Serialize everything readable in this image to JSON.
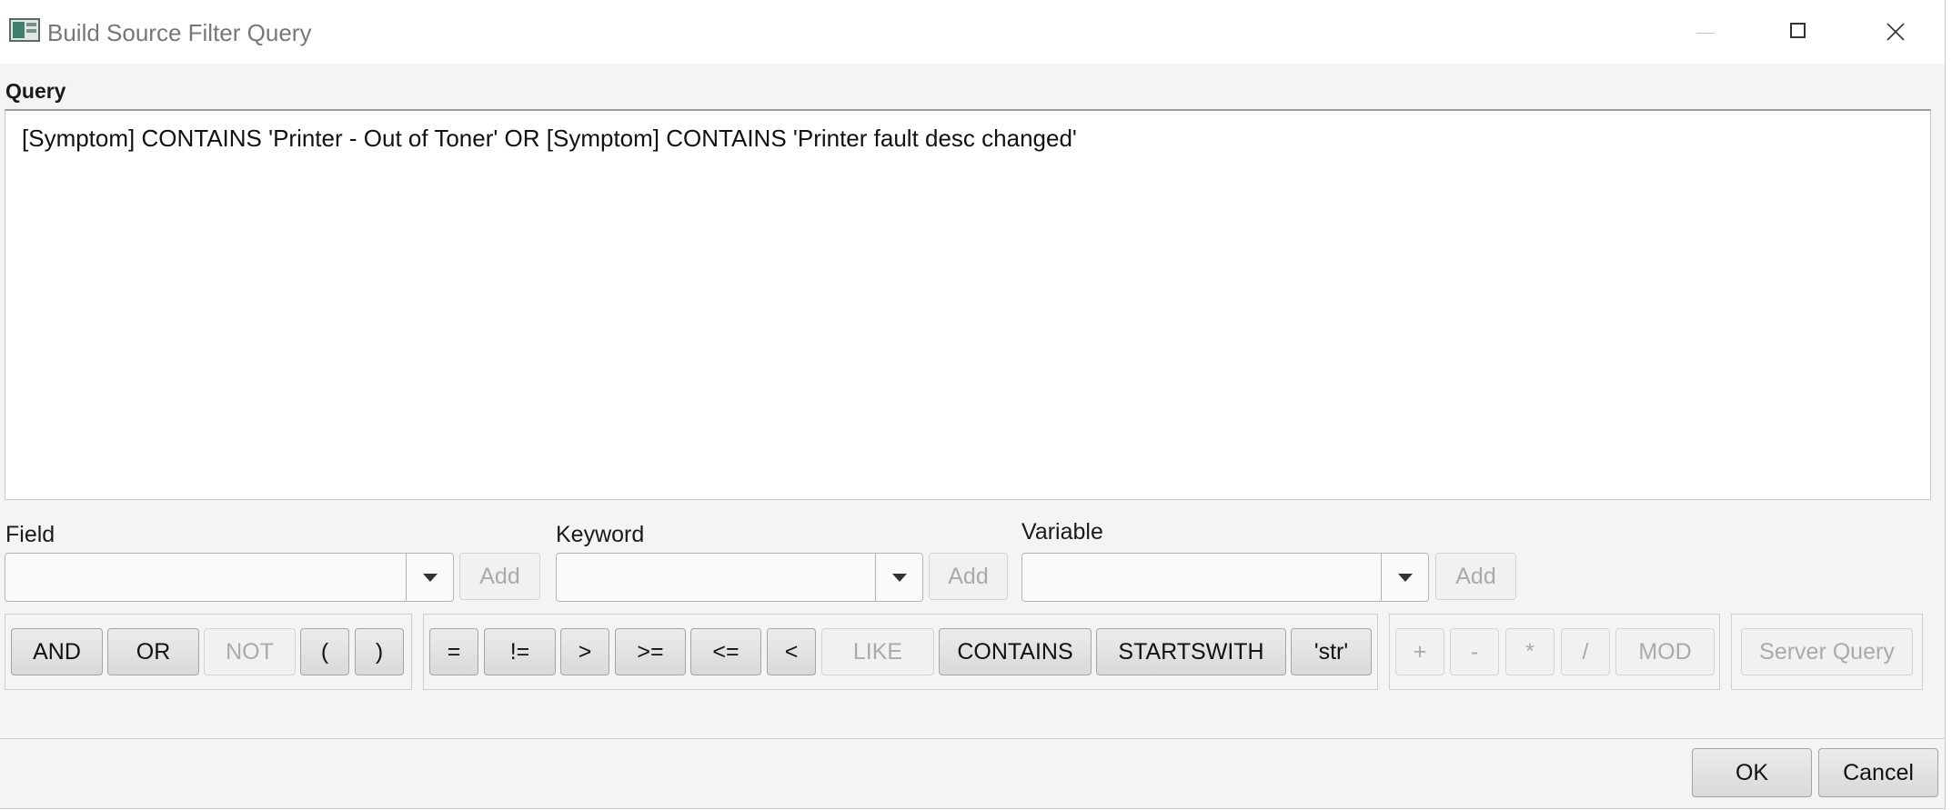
{
  "window": {
    "title": "Build Source Filter Query"
  },
  "query": {
    "label": "Query",
    "text": "[Symptom] CONTAINS 'Printer - Out of Toner' OR [Symptom] CONTAINS 'Printer fault desc changed'"
  },
  "field": {
    "label": "Field",
    "value": "",
    "add_label": "Add"
  },
  "keyword": {
    "label": "Keyword",
    "value": "",
    "add_label": "Add"
  },
  "variable": {
    "label": "Variable",
    "value": "",
    "add_label": "Add"
  },
  "logic_buttons": [
    {
      "label": "AND",
      "enabled": true
    },
    {
      "label": "OR",
      "enabled": true
    },
    {
      "label": "NOT",
      "enabled": false
    },
    {
      "label": "(",
      "enabled": true
    },
    {
      "label": ")",
      "enabled": true
    }
  ],
  "operator_buttons": [
    {
      "label": "=",
      "enabled": true
    },
    {
      "label": "!=",
      "enabled": true
    },
    {
      "label": ">",
      "enabled": true
    },
    {
      "label": ">=",
      "enabled": true
    },
    {
      "label": "<=",
      "enabled": true
    },
    {
      "label": "<",
      "enabled": true
    },
    {
      "label": "LIKE",
      "enabled": false
    },
    {
      "label": "CONTAINS",
      "enabled": true
    },
    {
      "label": "STARTSWITH",
      "enabled": true
    },
    {
      "label": "'str'",
      "enabled": true
    }
  ],
  "math_buttons": [
    {
      "label": "+",
      "enabled": false
    },
    {
      "label": "-",
      "enabled": false
    },
    {
      "label": "*",
      "enabled": false
    },
    {
      "label": "/",
      "enabled": false
    },
    {
      "label": "MOD",
      "enabled": false
    }
  ],
  "server_query_label": "Server Query",
  "footer": {
    "ok_label": "OK",
    "cancel_label": "Cancel"
  }
}
